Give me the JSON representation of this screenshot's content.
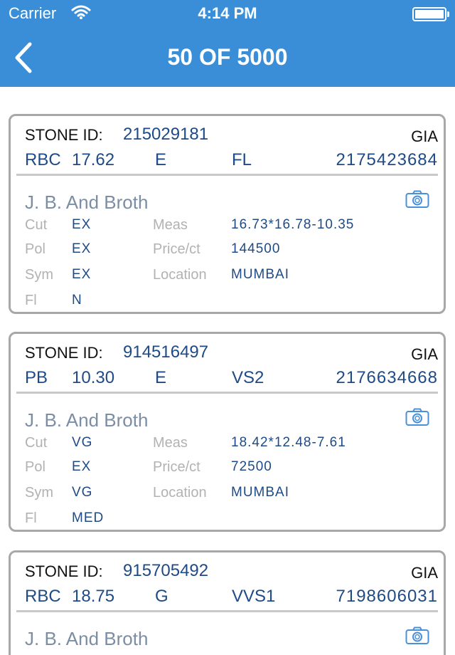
{
  "status_bar": {
    "carrier": "Carrier",
    "time": "4:14 PM"
  },
  "nav": {
    "title": "50 OF 5000"
  },
  "labels": {
    "stone_id": "STONE ID:",
    "cut": "Cut",
    "pol": "Pol",
    "sym": "Sym",
    "fl": "Fl",
    "meas": "Meas",
    "price": "Price/ct",
    "location": "Location"
  },
  "stones": [
    {
      "stone_id": "215029181",
      "lab": "GIA",
      "shape": "RBC",
      "carat": "17.62",
      "color": "E",
      "clarity": "FL",
      "cert_no": "2175423684",
      "supplier": "J. B. And Broth",
      "cut": "EX",
      "pol": "EX",
      "sym": "EX",
      "fl": "N",
      "meas": "16.73*16.78-10.35",
      "price": "144500",
      "location": "MUMBAI"
    },
    {
      "stone_id": "914516497",
      "lab": "GIA",
      "shape": "PB",
      "carat": "10.30",
      "color": "E",
      "clarity": "VS2",
      "cert_no": "2176634668",
      "supplier": "J. B. And Broth",
      "cut": "VG",
      "pol": "EX",
      "sym": "VG",
      "fl": "MED",
      "meas": "18.42*12.48-7.61",
      "price": "72500",
      "location": "MUMBAI"
    },
    {
      "stone_id": "915705492",
      "lab": "GIA",
      "shape": "RBC",
      "carat": "18.75",
      "color": "G",
      "clarity": "VVS1",
      "cert_no": "7198606031",
      "supplier": "J. B. And Broth"
    }
  ],
  "colors": {
    "header": "#3a8ed8",
    "value_blue": "#1e4a86",
    "supplier_gray": "#7b8ea4",
    "camera_blue": "#4a90d9"
  }
}
